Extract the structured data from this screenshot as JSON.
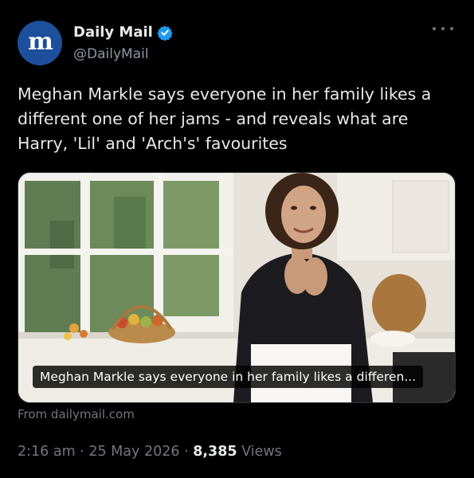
{
  "author": {
    "avatar_letter": "m",
    "display_name": "Daily Mail",
    "handle": "@DailyMail",
    "verified_icon": "verified-badge-icon",
    "avatar_color": "#1d4f9c"
  },
  "more_icon": "more-options-icon",
  "tweet": {
    "text": "Meghan Markle says everyone in her family likes a different one of her jams - and reveals what are Harry, 'Lil' and 'Arch's' favourites"
  },
  "media": {
    "caption": "Meghan Markle says everyone in her family likes a differen...",
    "source": "From dailymail.com"
  },
  "footer": {
    "time": "2:16 am",
    "separator": "·",
    "date": "25 May 2026",
    "views_count": "8,385",
    "views_label": "Views"
  },
  "colors": {
    "background": "#000000",
    "text": "#e7e9ea",
    "secondary": "#71767b",
    "verified": "#1d9bf0"
  }
}
